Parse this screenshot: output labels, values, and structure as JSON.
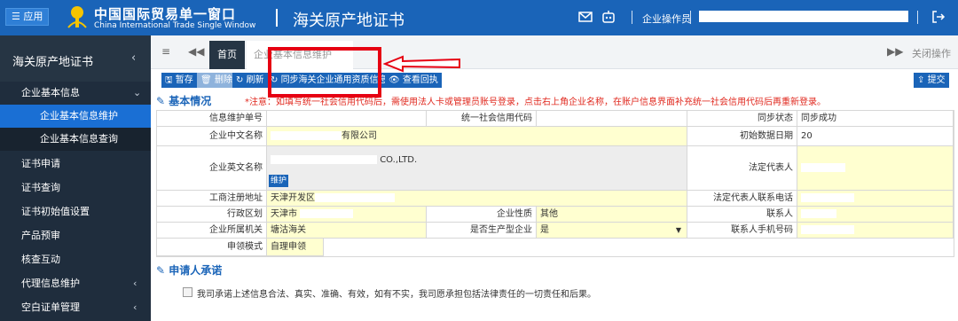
{
  "topbar": {
    "apps_label": "☰ 应用",
    "brand_cn": "中国国际贸易单一窗口",
    "brand_en": "China International Trade Single Window",
    "app_title": "海关原产地证书",
    "user_label": "企业操作员",
    "colors": {
      "bar": "#1a64b8"
    },
    "icons": [
      "mail-icon",
      "robot-icon",
      "logout-icon"
    ]
  },
  "sidebar": {
    "header": "海关原产地证书",
    "items": [
      {
        "label": "企业基本信息",
        "expanded": true
      },
      {
        "label": "企业基本信息维护",
        "active": true
      },
      {
        "label": "企业基本信息查询"
      },
      {
        "label": "证书申请"
      },
      {
        "label": "证书查询"
      },
      {
        "label": "证书初始值设置"
      },
      {
        "label": "产品预审"
      },
      {
        "label": "核查互动"
      },
      {
        "label": "代理信息维护"
      },
      {
        "label": "空白证单管理"
      }
    ]
  },
  "tabs": {
    "home": "首页",
    "active": "企业基本信息维护",
    "close_ops": "关闭操作"
  },
  "toolbar": {
    "save": "暂存",
    "delete": "删除",
    "refresh": "刷新",
    "sync": "同步海关企业通用资质信息",
    "receipt": "查看回执",
    "submit": "提交"
  },
  "sections": {
    "basic": "基本情况",
    "notice": "*注意：如填写统一社会信用代码后，需使用法人卡或管理员账号登录，点击右上角企业名称，在账户信息界面补充统一社会信用代码后再重新登录。",
    "applicant": "申请人承诺"
  },
  "form": {
    "labels": {
      "maint_no": "信息维护单号",
      "credit_code": "统一社会信用代码",
      "sync_status": "同步状态",
      "name_cn": "企业中文名称",
      "init_date": "初始数据日期",
      "name_en": "企业英文名称",
      "legal_rep": "法定代表人",
      "reg_address": "工商注册地址",
      "legal_phone": "法定代表人联系电话",
      "region": "行政区划",
      "nature": "企业性质",
      "contact": "联系人",
      "customs": "企业所属机关",
      "producer": "是否生产型企业",
      "contact_mobile": "联系人手机号码",
      "claim_mode": "申领模式"
    },
    "values": {
      "sync_status": "同步成功",
      "name_cn_suffix": "有限公司",
      "init_date": "20",
      "name_en_suffix": "CO.,LTD.",
      "maint_button": "维护",
      "reg_address": "天津开发区",
      "region": "天津市",
      "nature": "其他",
      "customs": "塘沽海关",
      "producer": "是",
      "claim_mode": "自理申领"
    }
  },
  "promise_text": "我司承诺上述信息合法、真实、准确、有效，如有不实，我司愿承担包括法律责任的一切责任和后果。"
}
